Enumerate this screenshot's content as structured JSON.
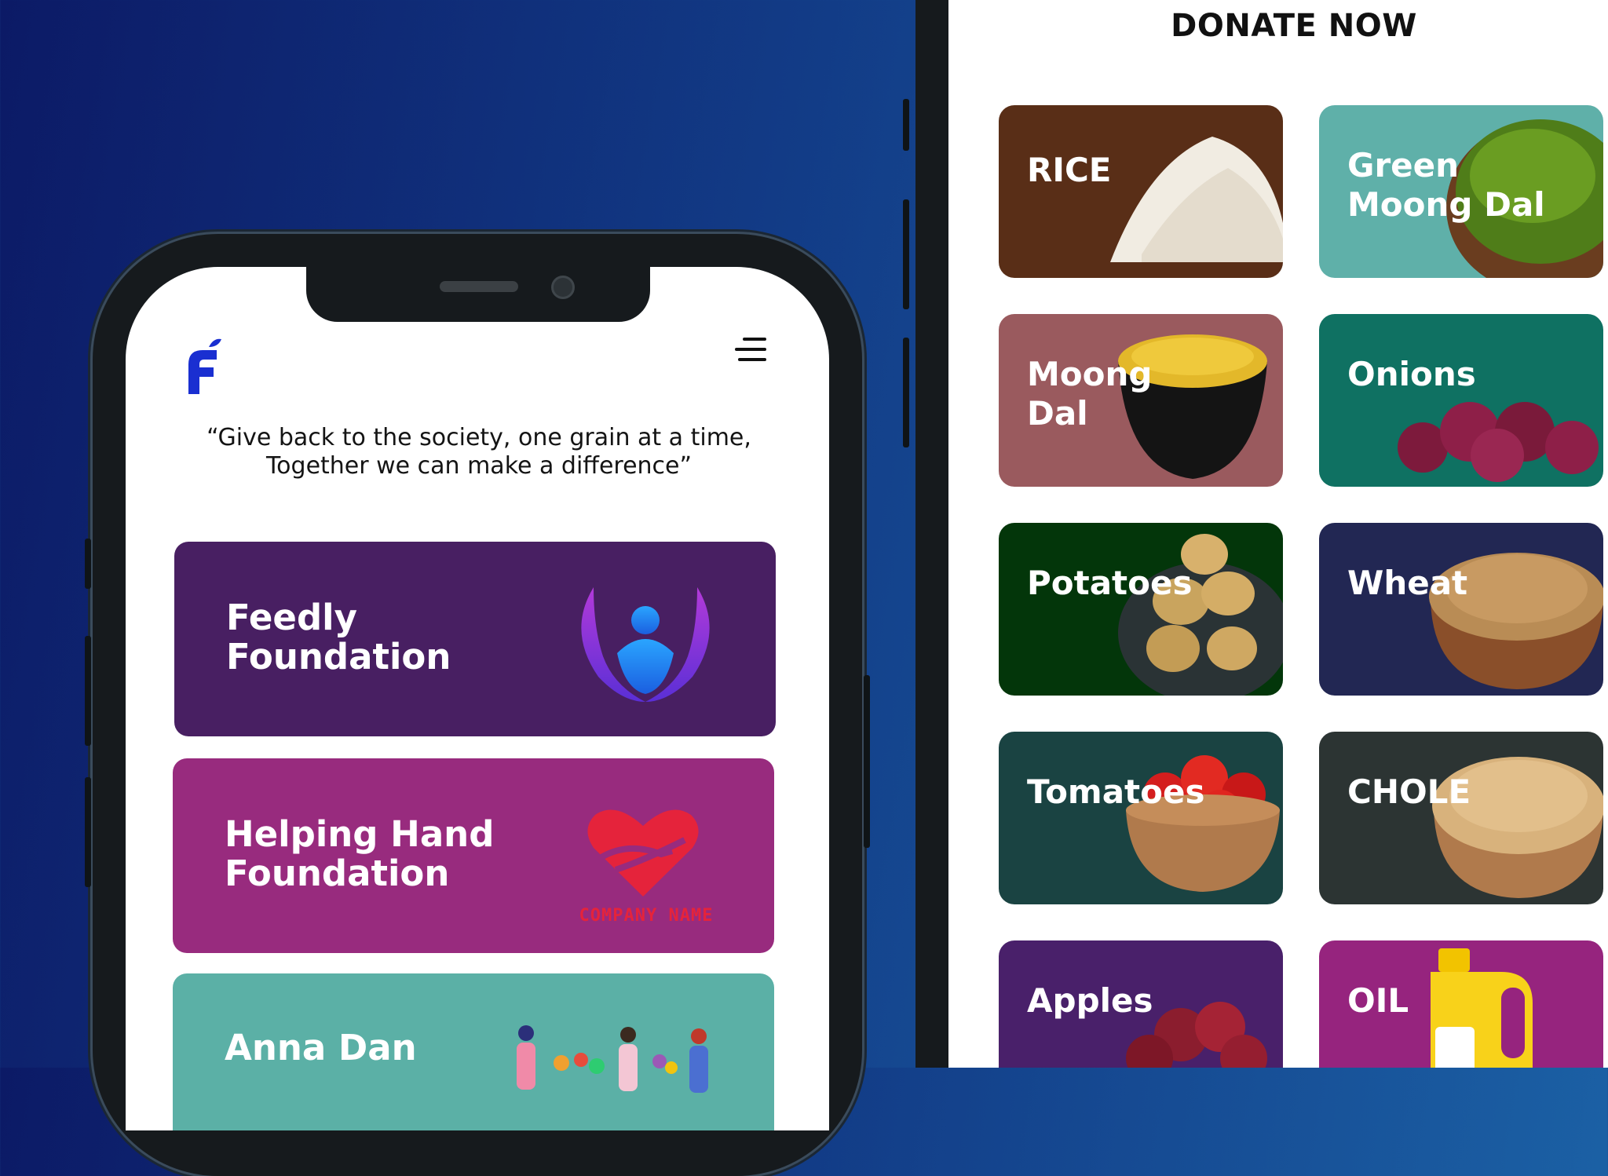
{
  "phone": {
    "tagline": "“Give back to the society, one grain at a time, Together we can make a difference”",
    "logo": {
      "icon": "feedly-f-logo",
      "color": "#1a2fd1"
    },
    "menu": {
      "icon": "hamburger-menu-icon"
    },
    "organizations": [
      {
        "name": "Feedly\nFoundation",
        "color": "#481f62",
        "icon": "hands-person-logo"
      },
      {
        "name": "Helping Hand\nFoundation",
        "color": "#982b7e",
        "icon": "heart-hands-logo",
        "logo_text": "COMPANY NAME"
      },
      {
        "name": "Anna Dan",
        "color": "#5bb0a6",
        "icon": "people-illustration"
      }
    ]
  },
  "donate": {
    "title": "DONATE NOW",
    "items": [
      {
        "label": "RICE",
        "color": "#592e17",
        "icon": "rice-pile"
      },
      {
        "label": "Green\nMoong Dal",
        "color": "#5fb0a9",
        "icon": "green-moong-bowl"
      },
      {
        "label": "Moong\nDal",
        "color": "#9a5a5e",
        "icon": "moong-dal-bowl"
      },
      {
        "label": "Onions",
        "color": "#0f7162",
        "icon": "onions"
      },
      {
        "label": "Potatoes",
        "color": "#03360a",
        "icon": "potato-bowl"
      },
      {
        "label": "Wheat",
        "color": "#222753",
        "icon": "wheat-bowl"
      },
      {
        "label": "Tomatoes",
        "color": "#1a4342",
        "icon": "tomato-bowl"
      },
      {
        "label": "CHOLE",
        "color": "#2c3433",
        "icon": "chole-bowl"
      },
      {
        "label": "Apples",
        "color": "#49206a",
        "icon": "apples"
      },
      {
        "label": "OIL",
        "color": "#96247e",
        "icon": "oil-can"
      }
    ]
  }
}
